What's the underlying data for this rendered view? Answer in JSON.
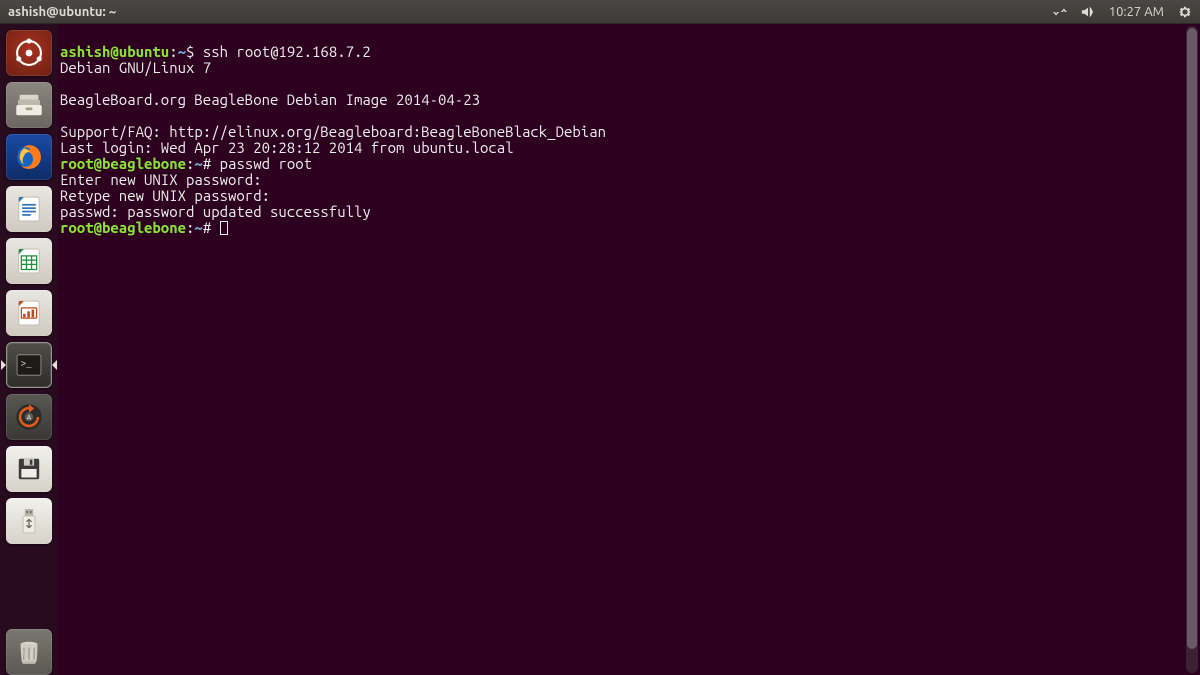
{
  "panel": {
    "title": "ashish@ubuntu: ~",
    "clock": "10:27 AM"
  },
  "launcher": {
    "items": [
      {
        "name": "dash",
        "label": "Dash"
      },
      {
        "name": "files",
        "label": "Files"
      },
      {
        "name": "firefox",
        "label": "Firefox"
      },
      {
        "name": "writer",
        "label": "LibreOffice Writer"
      },
      {
        "name": "calc",
        "label": "LibreOffice Calc"
      },
      {
        "name": "impress",
        "label": "LibreOffice Impress"
      },
      {
        "name": "terminal",
        "label": "Terminal"
      },
      {
        "name": "updater",
        "label": "Software Updater"
      },
      {
        "name": "floppy",
        "label": "Floppy Disk"
      },
      {
        "name": "usb",
        "label": "USB Drive"
      },
      {
        "name": "trash",
        "label": "Trash"
      }
    ]
  },
  "terminal": {
    "prompt1_user": "ashish@ubuntu",
    "prompt1_path": "~",
    "cmd1": "ssh root@192.168.7.2",
    "lines": [
      "Debian GNU/Linux 7",
      "",
      "BeagleBoard.org BeagleBone Debian Image 2014-04-23",
      "",
      "Support/FAQ: http://elinux.org/Beagleboard:BeagleBoneBlack_Debian",
      "Last login: Wed Apr 23 20:28:12 2014 from ubuntu.local"
    ],
    "prompt2_user": "root@beaglebone",
    "prompt2_path": "~",
    "cmd2": "passwd root",
    "lines2": [
      "Enter new UNIX password:",
      "Retype new UNIX password:",
      "passwd: password updated successfully"
    ],
    "prompt3_user": "root@beaglebone",
    "prompt3_path": "~"
  }
}
